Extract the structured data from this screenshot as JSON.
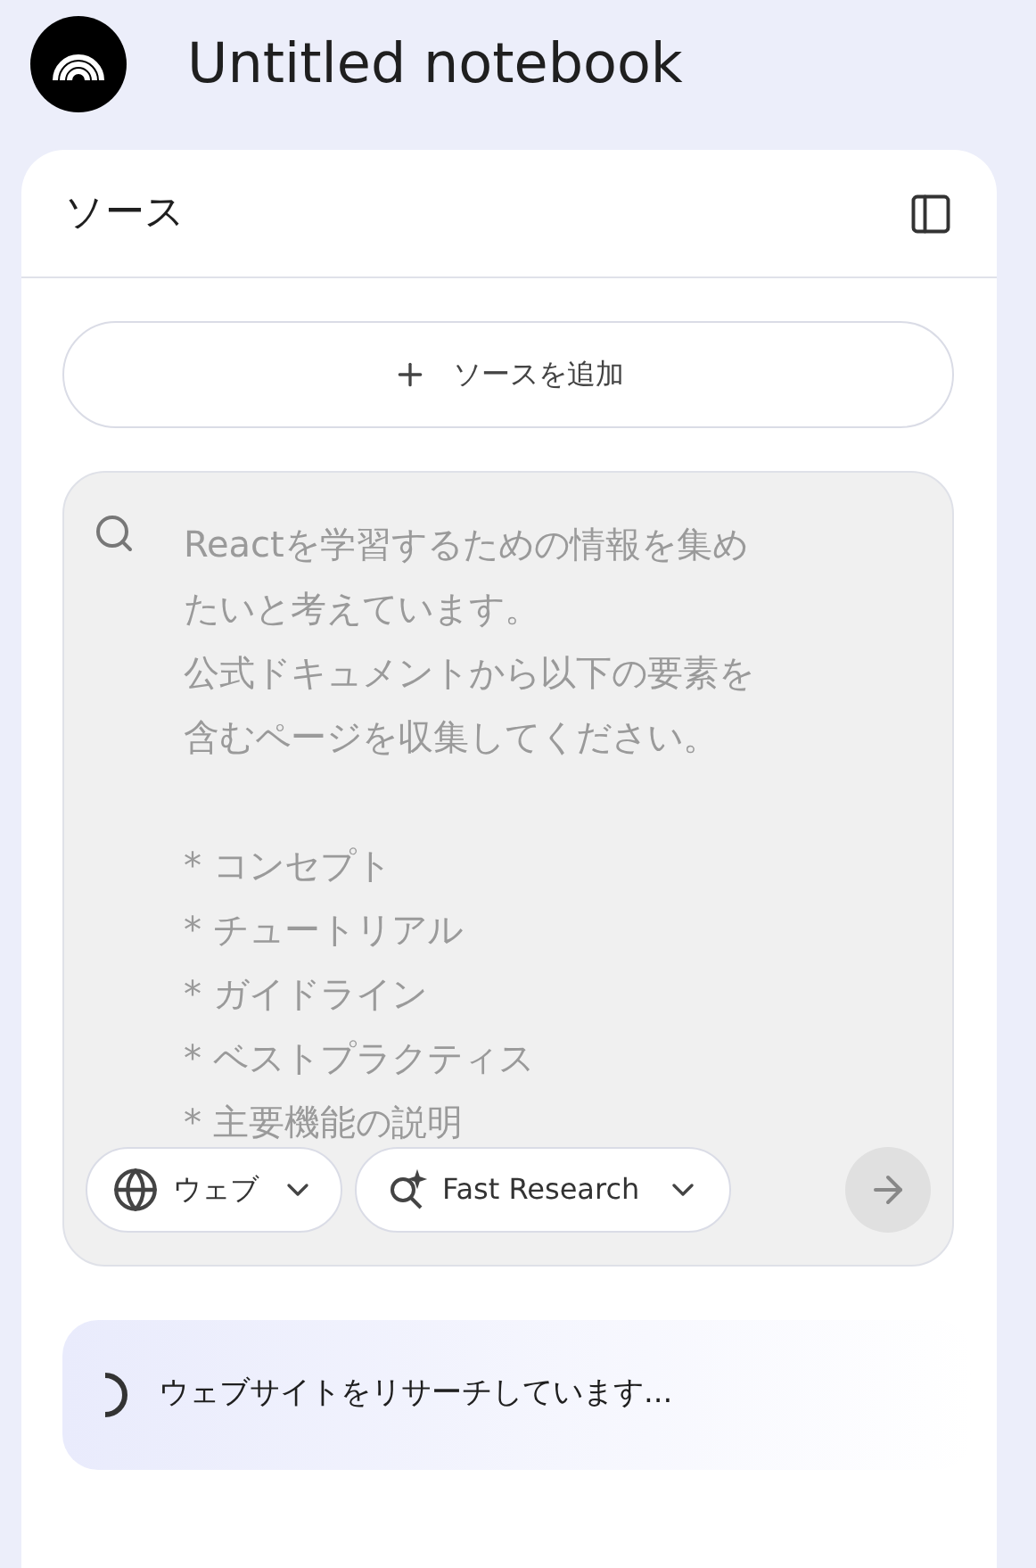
{
  "app": {
    "title": "Untitled notebook"
  },
  "sources_panel": {
    "title": "ソース",
    "add_button": "ソースを追加",
    "query": {
      "paragraphs": [
        [
          "Reactを学習するための情報を集め",
          "たいと考えています。",
          "公式ドキュメントから以下の要素を",
          "含むページを収集してください。"
        ],
        [
          "* コンセプト",
          "* チュートリアル",
          "* ガイドライン",
          "* ベストプラクティス",
          "* 主要機能の説明"
        ]
      ],
      "disabled": true
    },
    "source_type": "ウェブ",
    "research_mode": "Fast Research",
    "send_disabled": true,
    "status": {
      "text": "ウェブサイトをリサーチしています...",
      "loading": true
    }
  }
}
